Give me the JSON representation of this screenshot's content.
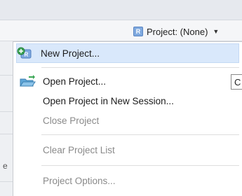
{
  "toolbar": {
    "project_button": {
      "label": "Project: (None)",
      "icon": "r-project-icon"
    }
  },
  "menu": {
    "items": [
      {
        "label": "New Project...",
        "icon": "new-project-icon",
        "enabled": true,
        "highlighted": true
      },
      {
        "label": "Open Project...",
        "icon": "open-project-icon",
        "enabled": true
      },
      {
        "label": "Open Project in New Session...",
        "enabled": true
      },
      {
        "label": "Close Project",
        "enabled": false
      },
      {
        "label": "Clear Project List",
        "enabled": false
      },
      {
        "label": "Project Options...",
        "enabled": false
      }
    ]
  },
  "tooltip_fragment": "C",
  "background_fragment": "e",
  "colors": {
    "highlight": "#d9e8fb",
    "disabled_text": "#8a8a8a"
  }
}
